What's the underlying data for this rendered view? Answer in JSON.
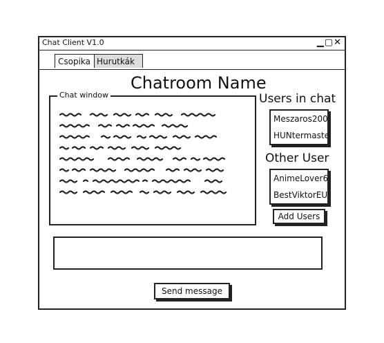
{
  "window": {
    "title": "Chat Client V1.0",
    "controls": "_ ▢ ✕"
  },
  "tabs": [
    {
      "label": "Csopika",
      "active": true
    },
    {
      "label": "Hurutkák",
      "active": false
    }
  ],
  "main": {
    "room_title": "Chatroom Name",
    "chat_window_label": "Chat window",
    "users_in_chat_title": "Users in chat",
    "users_in_chat": [
      "Meszaros200",
      "HUNtermaste"
    ],
    "other_users_title": "Other User",
    "other_users": [
      "AnimeLover6",
      "BestViktorEU"
    ],
    "add_users_label": "Add Users",
    "send_label": "Send message"
  }
}
